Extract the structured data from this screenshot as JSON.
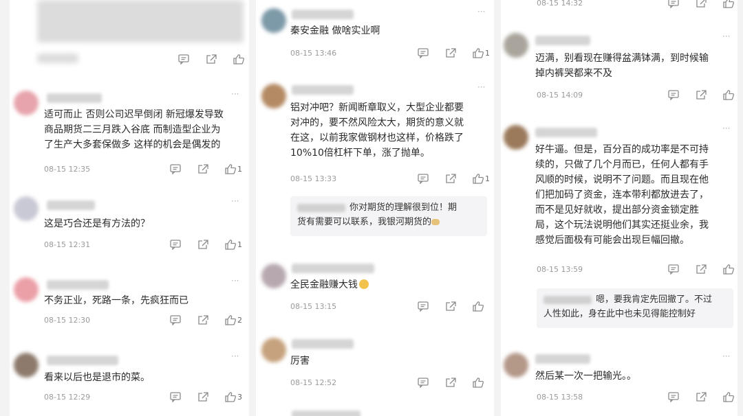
{
  "colors": {
    "bg": "#f3f3f3",
    "card": "#ffffff",
    "text": "#2a2a2a",
    "muted": "#9a9a9a",
    "reply_bg": "#f4f4f6"
  },
  "icons": {
    "comment": "comment-icon",
    "share": "share-icon",
    "like": "thumb-up-icon",
    "more": "more-icon"
  },
  "col1": {
    "top": {
      "like_count": ""
    },
    "items": [
      {
        "text": "适可而止 否则公司迟早倒闭 新冠爆发导致\n商品期货二三月跌入谷底 而制造型企业为\n了生产大多套保做多 这样的机会是偶发的",
        "time": "08-15 12:35",
        "likes": "1"
      },
      {
        "text": "这是巧合还是有方法的？",
        "time": "08-15 12:31",
        "likes": "1"
      },
      {
        "text": "不务正业，死路一条，先疯狂而已",
        "time": "08-15 12:30",
        "likes": "2"
      },
      {
        "text": "看来以后也是退市的菜。",
        "time": "08-15 12:29",
        "likes": "3"
      }
    ]
  },
  "col2": {
    "items": [
      {
        "text": "秦安金融 做啥实业啊",
        "time": "08-15 13:46",
        "likes": "1"
      },
      {
        "text": "铝对冲吧？新闻断章取义，大型企业都要\n对冲的，要不然风险太大，期货的意义就\n在这，以前我家做钢材也这样，价格跌了\n10%10倍杠杆下单，涨了抛单。",
        "time": "08-15 13:33",
        "likes": "1",
        "reply": "你对期货的理解很到位！期\n货有需要可以联系，我银河期货的"
      },
      {
        "text": "全民金融赚大钱",
        "time": "08-15 13:15",
        "likes": ""
      },
      {
        "text": "厉害",
        "time": "08-15 12:52",
        "likes": ""
      }
    ]
  },
  "col3": {
    "items": [
      {
        "text": "",
        "time": "08-15 14:32",
        "likes": ""
      },
      {
        "text": "迈满，别看现在赚得盆满钵满，到时候输\n掉内裤哭都来不及",
        "time": "08-15 14:09",
        "likes": ""
      },
      {
        "text": "好牛逼。但是，百分百的成功率是不可持\n续的，只做了几个月而已，任何人都有手\n风顺的时候，说明不了问题。而且现在他\n们把加码了资金，连本带利都放进去了，\n而不是见好就收，提出部分资金锁定胜\n局，这个玩法说明他们其实还挺业余，我\n感觉后面极有可能会出现巨幅回撤。",
        "time": "08-15 13:59",
        "likes": "",
        "reply": "嗯，要我肯定先回撤了。不过\n人性如此，身在此中也未见得能控制好"
      },
      {
        "text": "然后某一次一把输光。。",
        "time": "08-15 13:58",
        "likes": ""
      }
    ]
  }
}
